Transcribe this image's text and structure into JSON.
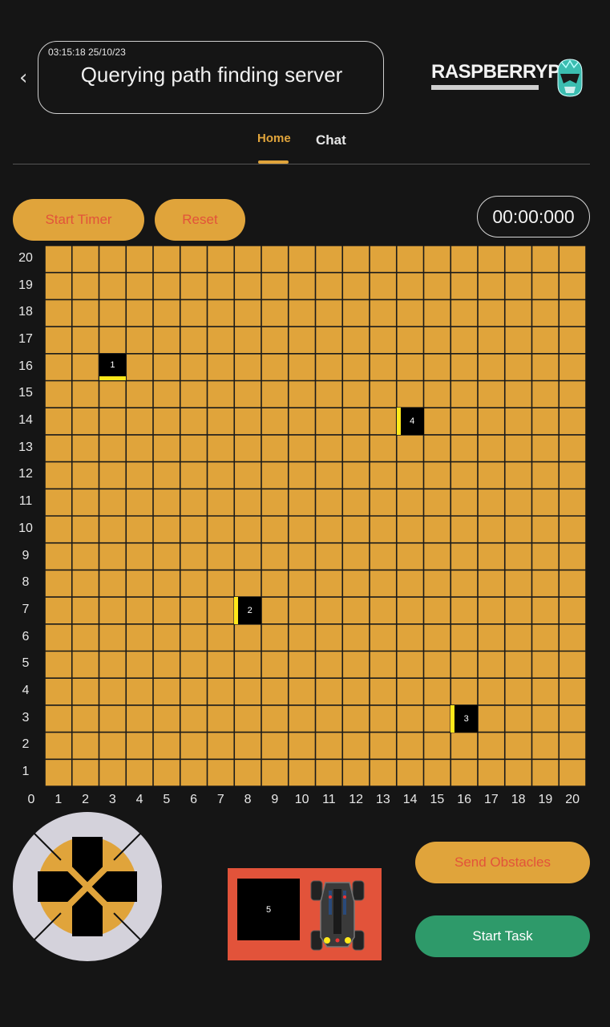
{
  "header": {
    "timestamp": "03:15:18 25/10/23",
    "status_message": "Querying path finding server",
    "brand": "RASPBERRYPI"
  },
  "tabs": [
    {
      "label": "Home",
      "active": true
    },
    {
      "label": "Chat",
      "active": false
    }
  ],
  "controls": {
    "start_timer_label": "Start Timer",
    "reset_label": "Reset",
    "timer_value": "00:00:000",
    "send_obstacles_label": "Send Obstacles",
    "start_task_label": "Start Task"
  },
  "grid": {
    "size": 20,
    "y_labels": [
      "20",
      "19",
      "18",
      "17",
      "16",
      "15",
      "14",
      "13",
      "12",
      "11",
      "10",
      "9",
      "8",
      "7",
      "6",
      "5",
      "4",
      "3",
      "2",
      "1"
    ],
    "x_labels": [
      "0",
      "1",
      "2",
      "3",
      "4",
      "5",
      "6",
      "7",
      "8",
      "9",
      "10",
      "11",
      "12",
      "13",
      "14",
      "15",
      "16",
      "17",
      "18",
      "19",
      "20"
    ],
    "obstacles": [
      {
        "id": "1",
        "x": 3,
        "y": 16,
        "face": "S"
      },
      {
        "id": "2",
        "x": 8,
        "y": 7,
        "face": "W"
      },
      {
        "id": "3",
        "x": 16,
        "y": 3,
        "face": "W"
      },
      {
        "id": "4",
        "x": 14,
        "y": 14,
        "face": "W"
      }
    ]
  },
  "robot_panel": {
    "obstacle_label": "5"
  },
  "colors": {
    "accent": "#e0a43b",
    "button_text": "#e2533a",
    "start_task": "#2e9a6a",
    "obstacle_face": "#ffe81a",
    "panel": "#e2533a"
  },
  "icons": {
    "back": "chevron-left-icon",
    "avatar": "ranger-helmet-icon",
    "dpad": "dpad-icon",
    "car": "robot-car-icon"
  }
}
